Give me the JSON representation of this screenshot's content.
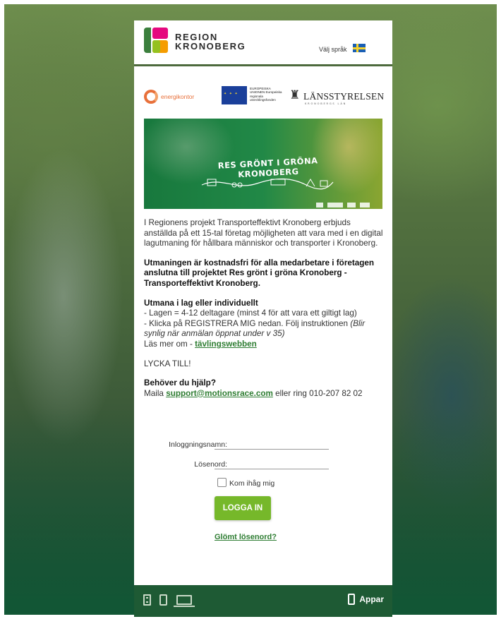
{
  "header": {
    "brand_line1": "REGION",
    "brand_line2": "KRONOBERG",
    "language_label": "Välj språk",
    "flag_icon": "swedish-flag-icon"
  },
  "sponsors": {
    "energikontor_label": "energikontor",
    "eu_label": "EUROPEISKA UNIONEN Europeiska regionala utvecklingsfonden",
    "lansstyrelsen_label": "LÄNSSTYRELSEN",
    "lansstyrelsen_sub": "KRONOBERGS LÄN"
  },
  "banner": {
    "title": "RES GRÖNT I GRÖNA KRONOBERG"
  },
  "intro": {
    "paragraph": "I Regionens projekt Transporteffektivt Kronoberg erbjuds anställda på ett 15-tal företag möjligheten att vara med i en digital lagutmaning för hållbara människor och transporter i Kronoberg.",
    "bold_paragraph": "Utmaningen är kostnadsfri för alla medarbetare i företagen anslutna till projektet Res grönt i gröna Kronoberg - Transporteffektivt Kronoberg."
  },
  "rules": {
    "heading": "Utmana i lag eller individuellt",
    "line1": "- Lagen = 4-12 deltagare (minst 4 för att vara ett giltigt lag)",
    "line2_prefix": "- Klicka på REGISTRERA MIG nedan. Följ instruktionen ",
    "line2_italic": "(Blir synlig när anmälan öppnat under v 35)",
    "read_more_prefix": "Läs mer om - ",
    "read_more_link": "tävlingswebben"
  },
  "good_luck": "LYCKA TILL!",
  "help": {
    "heading": "Behöver du hjälp?",
    "prefix": "Maila ",
    "email": "support@motionsrace.com",
    "suffix": " eller ring 010-207 82 02"
  },
  "login": {
    "username_label": "Inloggningsnamn:",
    "username_value": "",
    "password_label": "Lösenord:",
    "password_value": "",
    "remember_label": "Kom ihåg mig",
    "remember_checked": false,
    "submit_label": "LOGGA IN",
    "forgot_label": "Glömt lösenord?"
  },
  "footer": {
    "device_icons": [
      "tablet-icon",
      "phone-icon",
      "laptop-icon"
    ],
    "apps_label": "Appar"
  },
  "colors": {
    "accent_green": "#76b82a",
    "link_green": "#2e7d32",
    "footer_green": "#1e5a34"
  }
}
